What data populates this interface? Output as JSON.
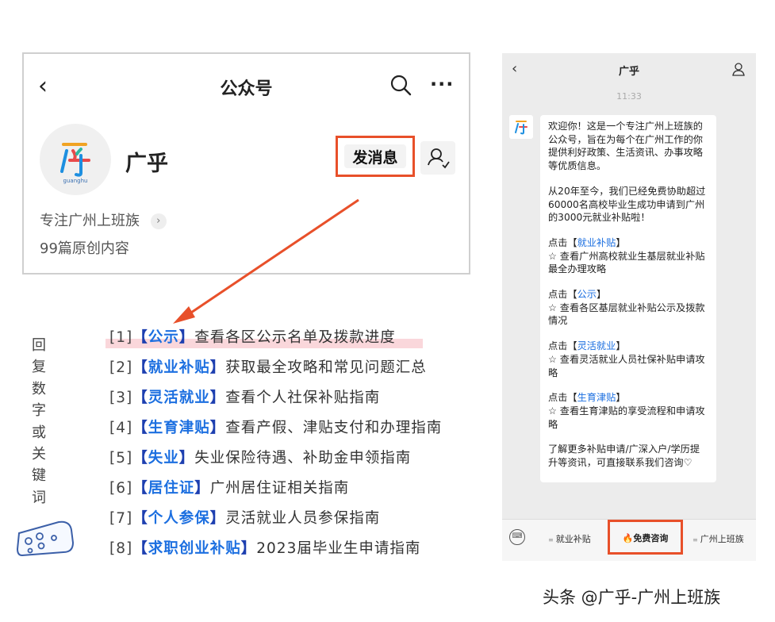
{
  "profile": {
    "back_icon": "back-chevron-icon",
    "title": "公众号",
    "name": "广乎",
    "send_message_label": "发消息",
    "tagline": "专注广州上班族",
    "original_count": "99篇原创内容",
    "avatar_logo_text": "广乎",
    "avatar_logo_sub": "guanghu"
  },
  "sidebar_prompt": [
    "回",
    "复",
    "数",
    "字",
    "或",
    "关",
    "键",
    "词"
  ],
  "keywords": [
    {
      "num": "[1]",
      "key": "公示",
      "desc": "查看各区公示名单及拨款进度"
    },
    {
      "num": "[2]",
      "key": "就业补贴",
      "desc": "获取最全攻略和常见问题汇总"
    },
    {
      "num": "[3]",
      "key": "灵活就业",
      "desc": "查看个人社保补贴指南"
    },
    {
      "num": "[4]",
      "key": "生育津贴",
      "desc": "查看产假、津贴支付和办理指南"
    },
    {
      "num": "[5]",
      "key": "失业",
      "desc": "失业保险待遇、补助金申领指南"
    },
    {
      "num": "[6]",
      "key": "居住证",
      "desc": "广州居住证相关指南"
    },
    {
      "num": "[7]",
      "key": "个人参保",
      "desc": "灵活就业人员参保指南"
    },
    {
      "num": "[8]",
      "key": "求职创业补贴",
      "desc": "2023届毕业生申请指南"
    }
  ],
  "chat": {
    "title": "广乎",
    "time": "11:33",
    "intro": "欢迎你！这是一个专注广州上班族的公众号，旨在为每个在广州工作的你提供利好政策、生活资讯、办事攻略等优质信息。",
    "stats": "从20年至今，我们已经免费协助超过60000名高校毕业生成功申请到广州的3000元就业补贴啦！",
    "blocks": [
      {
        "prefix": "点击【",
        "key": "就业补贴",
        "suffix": "】",
        "desc": "☆ 查看广州高校就业生基层就业补贴最全办理攻略"
      },
      {
        "prefix": "点击【",
        "key": "公示",
        "suffix": "】",
        "desc": "☆ 查看各区基层就业补贴公示及拨款情况"
      },
      {
        "prefix": "点击【",
        "key": "灵活就业",
        "suffix": "】",
        "desc": "☆ 查看灵活就业人员社保补贴申请攻略"
      },
      {
        "prefix": "点击【",
        "key": "生育津贴",
        "suffix": "】",
        "desc": "☆ 查看生育津贴的享受流程和申请攻略"
      }
    ],
    "outro": "了解更多补贴申请/广深入户/学历提升等资讯，可直接联系我们咨询♡",
    "menu": [
      "就业补贴",
      "🔥免费咨询",
      "广州上班族"
    ]
  },
  "watermark": "头条 @广乎-广州上班族",
  "colors": {
    "accent": "#e8502a",
    "link": "#1c6fe0",
    "bracket": "#1d3fb0",
    "highlight": "#f8c6cc"
  }
}
